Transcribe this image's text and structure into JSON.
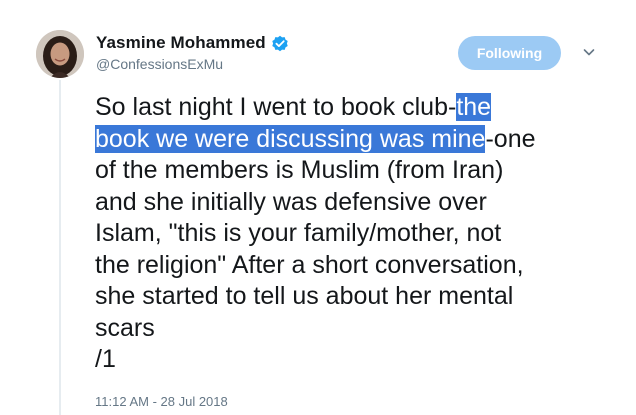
{
  "user": {
    "display_name": "Yasmine Mohammed",
    "handle": "@ConfessionsExMu",
    "verified": true
  },
  "follow_button": {
    "label": "Following",
    "color": "#9ccaf4"
  },
  "tweet": {
    "line1_pre": "So last night I went to book club-",
    "line1_hl": "the",
    "line2_hl": "book we were discussing was mine",
    "line2_post": "-one",
    "rest": [
      "of the members is Muslim (from Iran)",
      "and she initially was defensive over",
      "Islam, \"this is your family/mother, not",
      "the religion\" After a short conversation,",
      "she started to tell us about her mental",
      "scars",
      "/1"
    ],
    "timestamp": "11:12 AM - 28 Jul 2018"
  },
  "colors": {
    "highlight": "#3a78d8",
    "verified": "#1da1f2",
    "secondary_text": "#657786"
  },
  "icons": {
    "verified": "verified-badge-icon",
    "caret": "chevron-down-icon"
  }
}
